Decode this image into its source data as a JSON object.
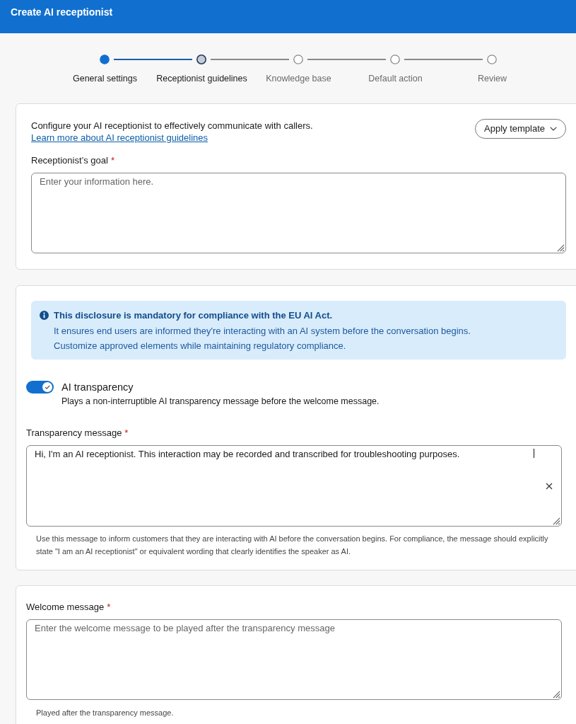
{
  "header": {
    "title": "Create AI receptionist"
  },
  "steps": [
    {
      "label": "General settings",
      "completed": true,
      "selected": false
    },
    {
      "label": "Receptionist guidelines",
      "completed": false,
      "selected": true
    },
    {
      "label": "Knowledge base",
      "completed": false,
      "selected": false
    },
    {
      "label": "Default action",
      "completed": false,
      "selected": false
    },
    {
      "label": "Review",
      "completed": false,
      "selected": false
    }
  ],
  "guidelines_card": {
    "intro": "Configure your AI receptionist to effectively communicate with callers.",
    "link": "Learn more about AI receptionist guidelines",
    "apply_template_button": "Apply template",
    "goal_field": {
      "label": "Receptionist’s goal",
      "required_mark": "*",
      "placeholder": "Enter your information here."
    }
  },
  "transparency_card": {
    "notice": {
      "title": "This disclosure is mandatory for compliance with the EU AI Act.",
      "lines": [
        "It ensures end users are informed they're interacting with an AI system before the conversation begins.",
        "Customize approved elements while maintaining regulatory compliance."
      ]
    },
    "toggle": {
      "label": "AI transparency",
      "description": "Plays a non-interruptible AI transparency message before the welcome message.",
      "on": true
    },
    "message_field": {
      "label": "Transparency message",
      "required_mark": "*",
      "value": "Hi, I'm an AI receptionist. This interaction may be recorded and transcribed for troubleshooting purposes.",
      "help": "Use this message to inform customers that they are interacting with AI before the conversation begins. For compliance, the message should explicitly state \"I am an AI receptionist\" or equivalent wording that clearly identifies the speaker as AI."
    }
  },
  "welcome_card": {
    "message_field": {
      "label": "Welcome message",
      "required_mark": "*",
      "placeholder": "Enter the welcome message to be played after the transparency message",
      "help": "Played after the transparency message."
    }
  }
}
